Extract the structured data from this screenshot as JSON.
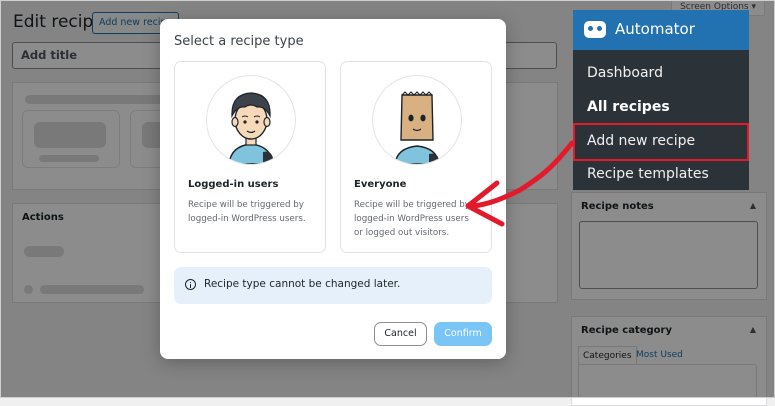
{
  "page": {
    "title": "Edit recipe",
    "add_new_button": "Add new recipe",
    "screen_options": "Screen Options",
    "title_placeholder": "Add title"
  },
  "actions_panel": {
    "heading": "Actions"
  },
  "admin_menu": {
    "header": "Automator",
    "items": [
      {
        "label": "Dashboard"
      },
      {
        "label": "All recipes"
      },
      {
        "label": "Add new recipe"
      },
      {
        "label": "Recipe templates"
      }
    ]
  },
  "sidebar": {
    "recipe_notes_heading": "Recipe notes",
    "recipe_category_heading": "Recipe category",
    "category_tabs": [
      "Categories",
      "Most Used"
    ]
  },
  "modal": {
    "title": "Select a recipe type",
    "options": [
      {
        "title": "Logged-in users",
        "description": "Recipe will be triggered by\nlogged-in WordPress users.",
        "icon": "user-avatar-icon"
      },
      {
        "title": "Everyone",
        "description": "Recipe will be triggered by\nlogged-in WordPress users\nor logged out visitors.",
        "icon": "anonymous-bag-avatar-icon"
      }
    ],
    "notice": "Recipe type cannot be changed later.",
    "cancel_label": "Cancel",
    "confirm_label": "Confirm"
  },
  "colors": {
    "menu_header": "#2271b1",
    "menu_bg": "#2c3338",
    "highlight": "#e21a2c",
    "info_bg": "#e6f0fb",
    "confirm_bg": "#79c5f5"
  }
}
